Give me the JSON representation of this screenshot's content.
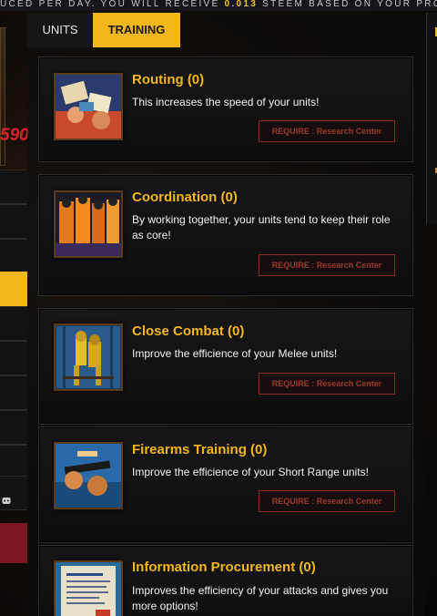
{
  "ticker": {
    "before": "UCED PER DAY. YOU WILL RECEIVE ",
    "amount": "0.013",
    "after": " STEEM BASED ON YOUR PRODUCTIO"
  },
  "left": {
    "partial_number": "590"
  },
  "tabs": [
    {
      "label": "UNITS",
      "active": false
    },
    {
      "label": "TRAINING",
      "active": true
    }
  ],
  "colors": {
    "accent": "#f4b71b",
    "require_border": "#8b2a22",
    "title": "#f4b71b"
  },
  "trainings": [
    {
      "title": "Routing (0)",
      "description": "This increases the speed of your units!",
      "require": "REQUIRE : Research Center",
      "icon": "routing-artwork"
    },
    {
      "title": "Coordination (0)",
      "description": "By working together, your units tend to keep their role as core!",
      "require": "REQUIRE : Research Center",
      "icon": "coordination-artwork"
    },
    {
      "title": "Close Combat (0)",
      "description": "Improve the efficience of your Melee units!",
      "require": "REQUIRE : Research Center",
      "icon": "close-combat-artwork"
    },
    {
      "title": "Firearms Training (0)",
      "description": "Improve the efficience of your Short Range units!",
      "require": "REQUIRE : Research Center",
      "icon": "firearms-artwork"
    },
    {
      "title": "Information Procurement (0)",
      "description": "Improves the efficiency of your attacks and gives you more options!",
      "require": "REQUIRE : Research Center",
      "icon": "information-artwork"
    }
  ]
}
